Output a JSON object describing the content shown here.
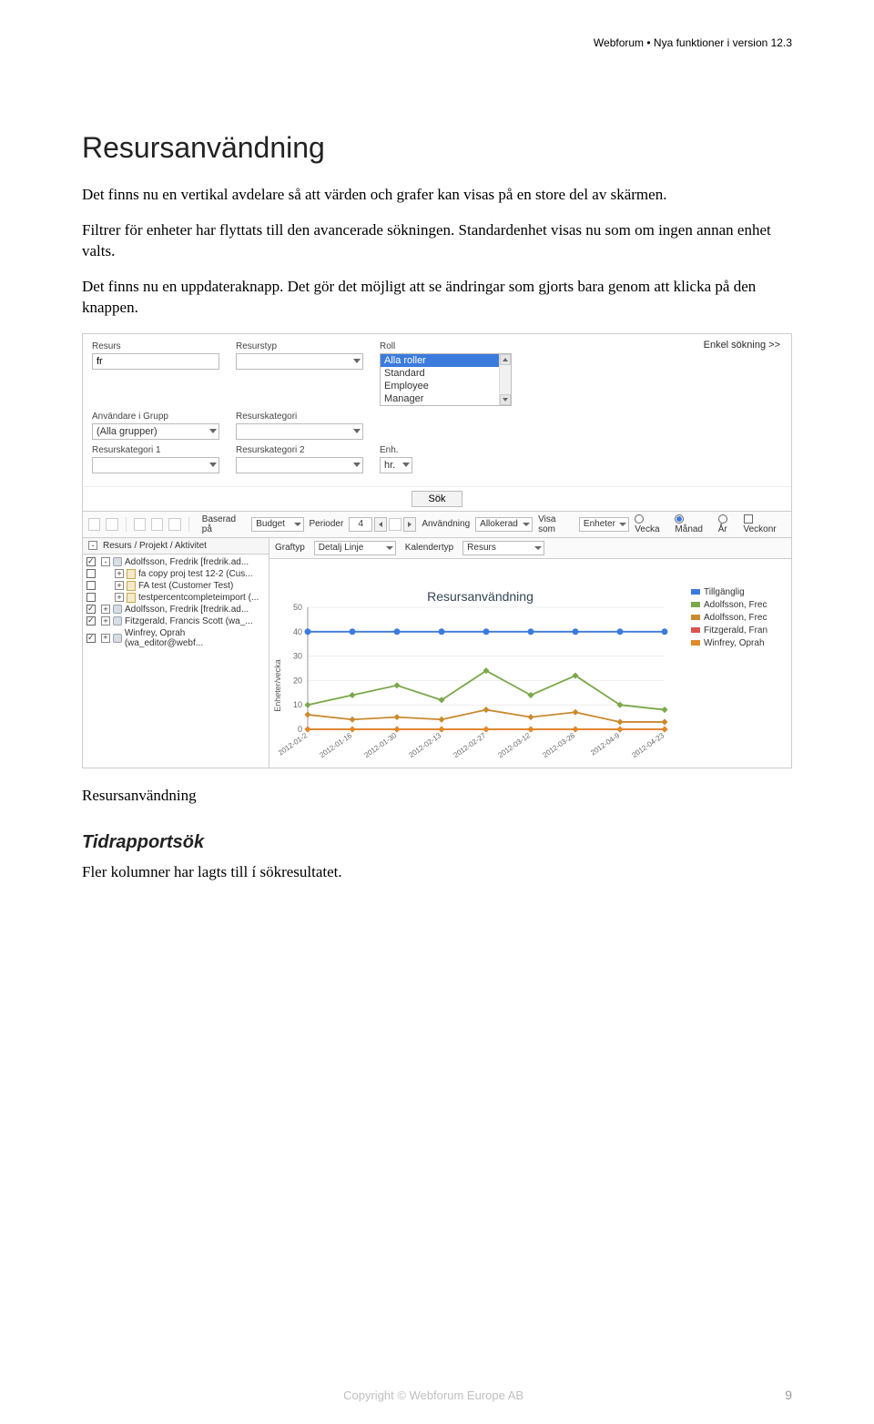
{
  "header": {
    "right": "Webforum • Nya funktioner i version 12.3"
  },
  "sections": {
    "title": "Resursanvändning",
    "p1": "Det finns nu en vertikal avdelare så att värden och grafer kan visas på en store del av skärmen.",
    "p2": "Filtrer för enheter har flyttats till den avancerade sökningen. Standardenhet visas nu som om ingen annan enhet valts.",
    "p3": "Det finns nu en uppdateraknapp. Det gör det möjligt att se ändringar som gjorts bara genom att klicka på den knappen.",
    "caption": "Resursanvändning",
    "h2": "Tidrapportsök",
    "p4": "Fler kolumner har lagts till í sökresultatet."
  },
  "filter": {
    "simple_link": "Enkel sökning >>",
    "labels": {
      "resurs": "Resurs",
      "resurstyp": "Resurstyp",
      "roll": "Roll",
      "anv_grupp": "Användare i Grupp",
      "resurskategori": "Resurskategori",
      "rk1": "Resurskategori 1",
      "rk2": "Resurskategori 2",
      "enh": "Enh."
    },
    "values": {
      "resurs": "fr",
      "anv_grupp": "(Alla grupper)",
      "enh": "hr."
    },
    "roll_options": [
      "Alla roller",
      "Standard",
      "Employee",
      "Manager"
    ],
    "sok": "Sök"
  },
  "toolbar": {
    "baserad": "Baserad på",
    "budget": "Budget",
    "perioder": "Perioder",
    "perioder_val": "4",
    "anvandning": "Användning",
    "allokerad": "Allokerad",
    "visa_som": "Visa som",
    "enheter": "Enheter",
    "vecka": "Vecka",
    "manad": "Månad",
    "ar": "År",
    "veckonr": "Veckonr"
  },
  "chartbar": {
    "graftyp": "Graftyp",
    "graftyp_val": "Detalj Linje",
    "kalendertyp": "Kalendertyp",
    "kalendertyp_val": "Resurs"
  },
  "tree": {
    "header": "Resurs / Projekt / Aktivitet",
    "items": [
      {
        "kind": "person",
        "check": true,
        "exp": "-",
        "label": "Adolfsson, Fredrik [fredrik.ad..."
      },
      {
        "kind": "doc",
        "check": false,
        "exp": "+",
        "label": "fa copy proj test 12-2 (Cus..."
      },
      {
        "kind": "doc",
        "check": false,
        "exp": "+",
        "label": "FA test (Customer Test)"
      },
      {
        "kind": "doc",
        "check": false,
        "exp": "+",
        "label": "testpercentcompleteimport (..."
      },
      {
        "kind": "person",
        "check": true,
        "exp": "+",
        "label": "Adolfsson, Fredrik [fredrik.ad..."
      },
      {
        "kind": "person",
        "check": true,
        "exp": "+",
        "label": "Fitzgerald, Francis Scott (wa_..."
      },
      {
        "kind": "person",
        "check": true,
        "exp": "+",
        "label": "Winfrey, Oprah (wa_editor@webf..."
      }
    ]
  },
  "chart_data": {
    "type": "line",
    "title": "Resursanvändning",
    "xlabel": "",
    "ylabel": "Enheter/vecka",
    "ylim": [
      0,
      50
    ],
    "categories": [
      "2012-01-2",
      "2012-01-16",
      "2012-01-30",
      "2012-02-13",
      "2012-02-27",
      "2012-03-12",
      "2012-03-26",
      "2012-04-9",
      "2012-04-23"
    ],
    "series": [
      {
        "name": "Tillgänglig",
        "color": "#3b7bdd",
        "values": [
          40,
          40,
          40,
          40,
          40,
          40,
          40,
          40,
          40
        ]
      },
      {
        "name": "Adolfsson, Fredrik",
        "color": "#7aa84a",
        "values": [
          10,
          14,
          18,
          12,
          24,
          14,
          22,
          10,
          8
        ]
      },
      {
        "name": "Adolfsson, Fredrik",
        "color": "#c98a2f",
        "values": [
          6,
          4,
          5,
          4,
          8,
          5,
          7,
          3,
          3
        ]
      },
      {
        "name": "Fitzgerald, Francis",
        "color": "#d9534f",
        "values": [
          0,
          0,
          0,
          0,
          0,
          0,
          0,
          0,
          0
        ]
      },
      {
        "name": "Winfrey, Oprah",
        "color": "#e08a2a",
        "values": [
          0,
          0,
          0,
          0,
          0,
          0,
          0,
          0,
          0
        ]
      }
    ],
    "legend": [
      "Tillgänglig",
      "Adolfsson, Frec",
      "Adolfsson, Frec",
      "Fitzgerald, Fran",
      "Winfrey, Oprah"
    ]
  },
  "footer": {
    "copyright": "Copyright © Webforum Europe AB",
    "page": "9"
  }
}
